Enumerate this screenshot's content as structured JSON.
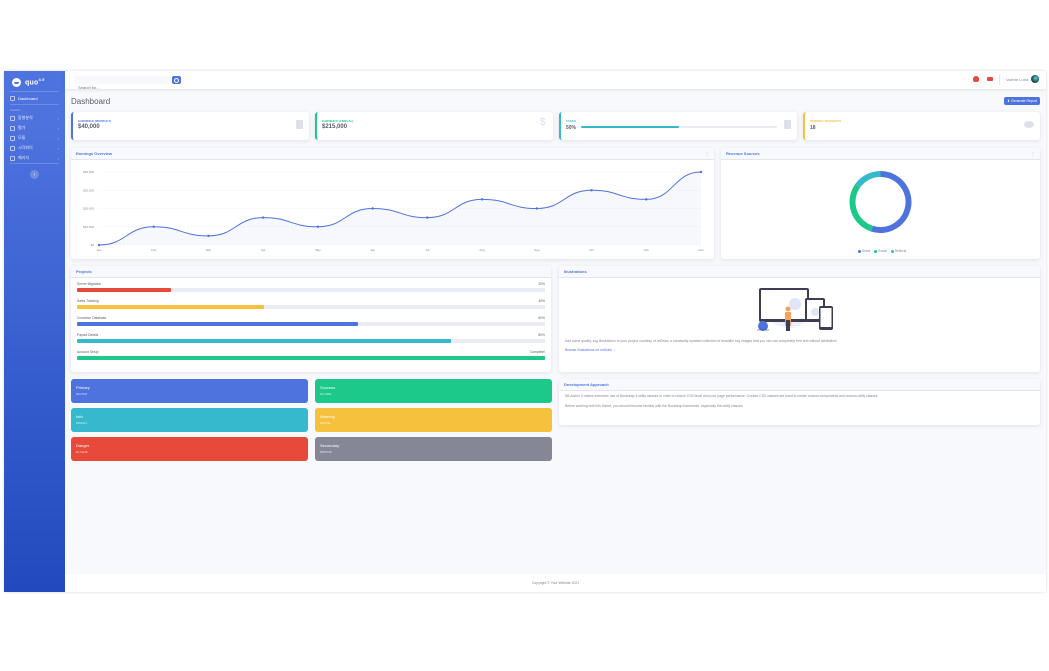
{
  "sidebar": {
    "brand_text": "quo",
    "brand_sup": "4.5",
    "dashboard_label": "Dashboard",
    "heading": "CHART",
    "items": [
      {
        "label": "동향분석"
      },
      {
        "label": "평가"
      },
      {
        "label": "모듈"
      },
      {
        "label": "시각화이"
      },
      {
        "label": "패키지"
      }
    ],
    "toggle_glyph": "‹"
  },
  "topbar": {
    "search_placeholder": "Search for...",
    "user_name": "Valerie Luna"
  },
  "page": {
    "title": "Dashboard",
    "report_button": "⬇ Generate Report",
    "footer": "Copyright © Your Website 2021"
  },
  "stats": [
    {
      "label": "Earnings (Monthly)",
      "value": "$40,000",
      "color": "#4e73df"
    },
    {
      "label": "Earnings (Annual)",
      "value": "$215,000",
      "color": "#1cc88a"
    },
    {
      "label": "Tasks",
      "value": "50%",
      "color": "#36b9cc",
      "progress": 0.5
    },
    {
      "label": "Pending Requests",
      "value": "18",
      "color": "#f6c23e"
    }
  ],
  "earnings": {
    "title": "Earnings Overview",
    "menu_glyph": "⋮"
  },
  "revenue": {
    "title": "Revenue Sources",
    "menu_glyph": "⋮"
  },
  "chart_data": [
    {
      "type": "area",
      "categories": [
        "Jan",
        "Feb",
        "Mar",
        "Apr",
        "May",
        "Jun",
        "Jul",
        "Aug",
        "Sep",
        "Oct",
        "Nov",
        "Dec"
      ],
      "values": [
        0,
        10000,
        5000,
        15000,
        10000,
        20000,
        15000,
        25000,
        20000,
        30000,
        25000,
        40000
      ],
      "ytick_labels": [
        "$0",
        "$10,000",
        "$20,000",
        "$30,000",
        "$40,000"
      ],
      "ylim": [
        0,
        40000
      ],
      "grid": true,
      "color": "#4e73df",
      "fill": "rgba(78,115,223,0.05)"
    },
    {
      "type": "pie",
      "labels": [
        "Direct",
        "Social",
        "Referral"
      ],
      "values": [
        55,
        30,
        15
      ],
      "colors": [
        "#4e73df",
        "#1cc88a",
        "#36b9cc"
      ],
      "legend_position": "bottom"
    }
  ],
  "projects": {
    "title": "Projects",
    "items": [
      {
        "name": "Server Migration",
        "pct_label": "20%",
        "progress": 0.2,
        "color": "#e74a3b"
      },
      {
        "name": "Sales Tracking",
        "pct_label": "40%",
        "progress": 0.4,
        "color": "#f6c23e"
      },
      {
        "name": "Customer Database",
        "pct_label": "60%",
        "progress": 0.6,
        "color": "#4e73df"
      },
      {
        "name": "Payout Details",
        "pct_label": "80%",
        "progress": 0.8,
        "color": "#36b9cc"
      },
      {
        "name": "Account Setup",
        "pct_label": "Complete!",
        "progress": 1.0,
        "color": "#1cc88a"
      }
    ]
  },
  "color_cards": [
    {
      "title": "Primary",
      "hex": "#4e73df",
      "color": "#4e73df"
    },
    {
      "title": "Success",
      "hex": "#1cc88a",
      "color": "#1cc88a"
    },
    {
      "title": "Info",
      "hex": "#36b9cc",
      "color": "#36b9cc"
    },
    {
      "title": "Warning",
      "hex": "#f6c23e",
      "color": "#f6c23e"
    },
    {
      "title": "Danger",
      "hex": "#e74a3b",
      "color": "#e74a3b"
    },
    {
      "title": "Secondary",
      "hex": "#858796",
      "color": "#858796"
    }
  ],
  "illustrations": {
    "title": "Illustrations",
    "text": "Add some quality, svg illustrations to your project courtesy of unDraw, a constantly updated collection of beautiful svg images that you can use completely free and without attribution!",
    "link": "Browse Illustrations on unDraw →"
  },
  "approach": {
    "title": "Development Approach",
    "p1": "SB Admin 2 makes extensive use of Bootstrap 4 utility classes in order to reduce CSS bloat and poor page performance. Custom CSS classes are used to create custom components and custom utility classes.",
    "p2": "Before working with this theme, you should become familiar with the Bootstrap framework, especially the utility classes."
  }
}
